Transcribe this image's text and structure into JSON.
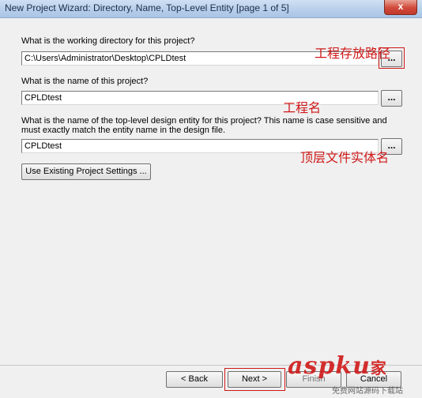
{
  "window": {
    "title": "New Project Wizard: Directory, Name, Top-Level Entity [page 1 of 5]",
    "close_label": "x"
  },
  "form": {
    "dir_label": "What is the working directory for this project?",
    "dir_value": "C:\\Users\\Administrator\\Desktop\\CPLDtest",
    "name_label": "What is the name of this project?",
    "name_value": "CPLDtest",
    "entity_label": "What is the name of the top-level design entity for this project? This name is case sensitive and must exactly match the entity name in the design file.",
    "entity_value": "CPLDtest",
    "browse_label": "...",
    "use_existing_label": "Use Existing Project Settings ..."
  },
  "annotations": {
    "path_note": "工程存放路径",
    "name_note": "工程名",
    "entity_note": "顶层文件实体名"
  },
  "footer": {
    "back_label": "< Back",
    "next_label": "Next >",
    "finish_label": "Finish",
    "cancel_label": "Cancel"
  },
  "watermark": {
    "logo": "aspku",
    "suffix": "家",
    "sub": "免费网站源码下载站"
  }
}
